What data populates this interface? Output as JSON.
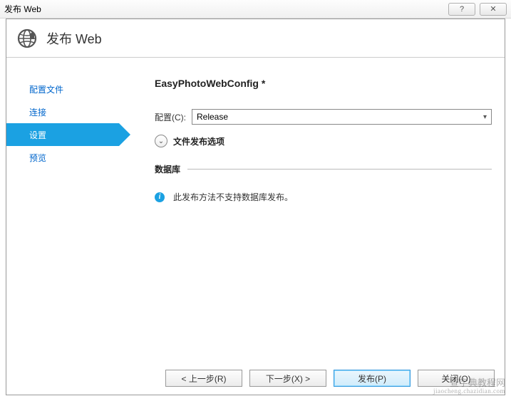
{
  "titlebar": {
    "title": "发布 Web"
  },
  "header": {
    "title": "发布 Web"
  },
  "sidebar": {
    "items": [
      {
        "label": "配置文件",
        "active": false
      },
      {
        "label": "连接",
        "active": false
      },
      {
        "label": "设置",
        "active": true
      },
      {
        "label": "预览",
        "active": false
      }
    ]
  },
  "main": {
    "profile_name": "EasyPhotoWebConfig *",
    "config_label": "配置(C):",
    "config_value": "Release",
    "file_options_label": "文件发布选项",
    "database_heading": "数据库",
    "info_message": "此发布方法不支持数据库发布。"
  },
  "footer": {
    "prev": "< 上一步(R)",
    "next": "下一步(X) >",
    "publish": "发布(P)",
    "close": "关闭(O)"
  },
  "watermark": {
    "line1": "查字典教程网",
    "line2": "jiaocheng.chazidian.com"
  }
}
